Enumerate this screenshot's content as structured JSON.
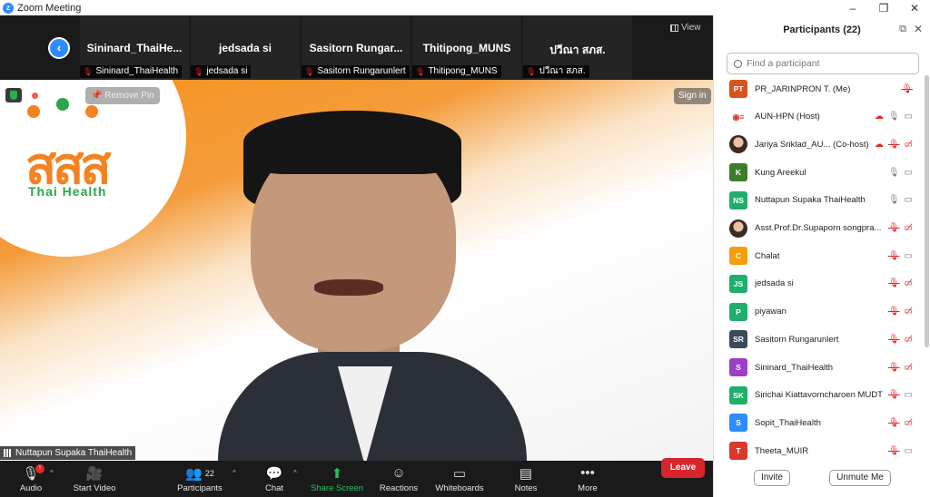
{
  "window": {
    "title": "Zoom Meeting",
    "minimize": "–",
    "restore": "❐",
    "close": "✕"
  },
  "strip": {
    "tiles": [
      {
        "name": "Sininard_ThaiHe...",
        "label": "Sininard_ThaiHealth"
      },
      {
        "name": "jedsada si",
        "label": "jedsada si"
      },
      {
        "name": "Sasitorn  Rungar...",
        "label": "Sasitorn Rungarunlert"
      },
      {
        "name": "Thitipong_MUNS",
        "label": "Thitipong_MUNS"
      },
      {
        "name": "ปวีณา สภส.",
        "label": "ปวีณา สภส."
      }
    ],
    "view_label": "View"
  },
  "video": {
    "logo_text": "สสส",
    "logo_sub": "Thai Health",
    "remove_pin": "Remove Pin",
    "sign_in": "Sign in",
    "speaker_name": "Nuttapun  Supaka ThaiHealth"
  },
  "toolbar": {
    "audio": "Audio",
    "audio_badge": "!",
    "video": "Start Video",
    "participants": "Participants",
    "participants_count": "22",
    "chat": "Chat",
    "share": "Share Screen",
    "reactions": "Reactions",
    "whiteboards": "Whiteboards",
    "notes": "Notes",
    "more": "More",
    "leave": "Leave"
  },
  "colors": {
    "accent": "#2d8cff",
    "leave": "#d6262b",
    "share": "#22c55e",
    "muted": "#e02828"
  },
  "panel": {
    "title": "Participants (22)",
    "search_placeholder": "Find a participant",
    "invite": "Invite",
    "unmute_me": "Unmute Me",
    "participants": [
      {
        "initials": "PT",
        "color": "#d9531e",
        "name": "PR_JARINPRON T. (Me)",
        "mic": "off",
        "video": "none"
      },
      {
        "initials": "",
        "color": "#ffffff",
        "name": "AUN-HPN (Host)",
        "mic": "on",
        "video": "on",
        "rec": true,
        "logo": true
      },
      {
        "initials": "",
        "color": "#ffffff",
        "name": "Jariya Sriklad_AU... (Co-host)",
        "mic": "off",
        "video": "off",
        "rec": true,
        "photo": true
      },
      {
        "initials": "K",
        "color": "#3c7d2b",
        "name": "Kung Areekul",
        "mic": "on",
        "video": "on"
      },
      {
        "initials": "NS",
        "color": "#1fae6b",
        "name": "Nuttapun Supaka ThaiHealth",
        "mic": "active",
        "video": "on"
      },
      {
        "initials": "",
        "color": "#ffffff",
        "name": "Asst.Prof.Dr.Supaporn songpra...",
        "mic": "off",
        "video": "off",
        "photo": true
      },
      {
        "initials": "C",
        "color": "#f59e0b",
        "name": "Chalat",
        "mic": "off",
        "video": "on"
      },
      {
        "initials": "JS",
        "color": "#1fae6b",
        "name": "jedsada si",
        "mic": "off",
        "video": "off"
      },
      {
        "initials": "P",
        "color": "#1fae6b",
        "name": "piyawan",
        "mic": "off",
        "video": "off"
      },
      {
        "initials": "SR",
        "color": "#3b4a5a",
        "name": "Sasitorn Rungarunlert",
        "mic": "off",
        "video": "off"
      },
      {
        "initials": "S",
        "color": "#9b3fc6",
        "name": "Sininard_ThaiHealth",
        "mic": "off",
        "video": "off"
      },
      {
        "initials": "SK",
        "color": "#1fae6b",
        "name": "Sirichai Kiattavorncharoen MUDT",
        "mic": "off",
        "video": "on"
      },
      {
        "initials": "S",
        "color": "#2d8cff",
        "name": "Sopit_ThaiHealth",
        "mic": "off",
        "video": "off"
      },
      {
        "initials": "T",
        "color": "#d9392b",
        "name": "Theeta_MUIR",
        "mic": "off",
        "video": "on"
      }
    ]
  }
}
